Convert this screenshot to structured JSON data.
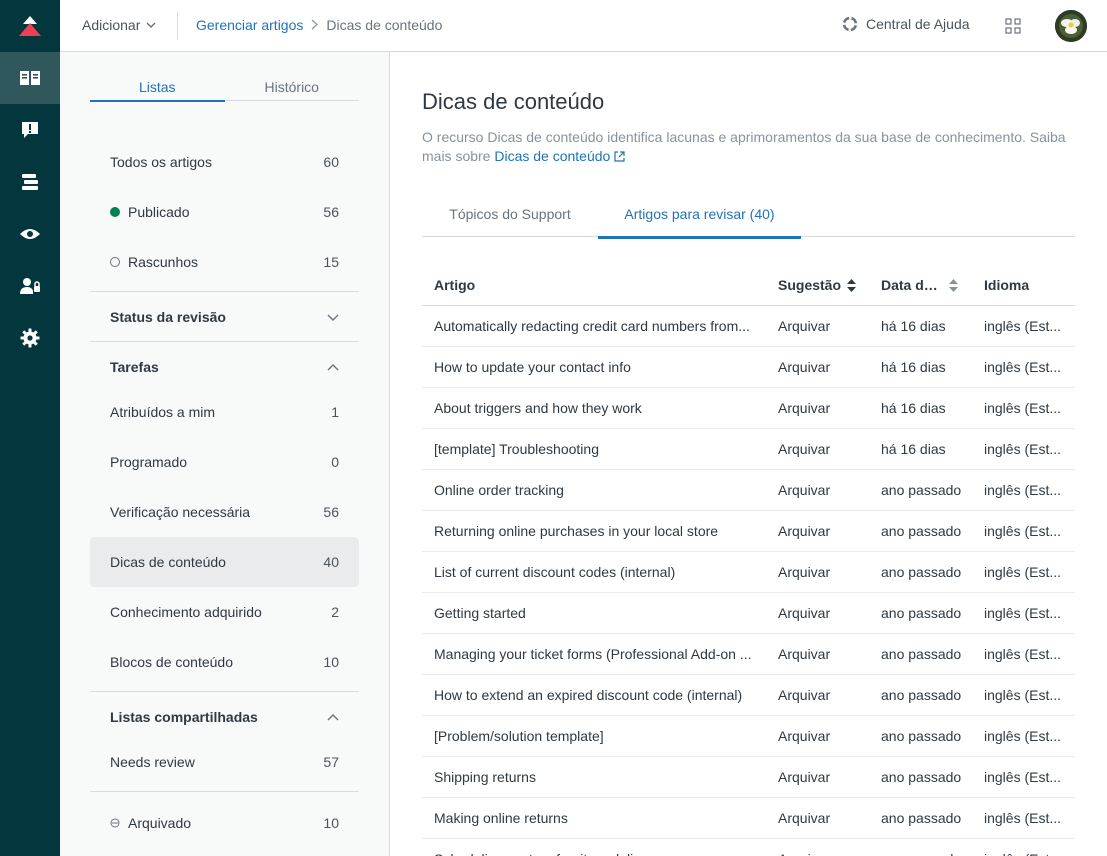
{
  "topbar": {
    "add_label": "Adicionar",
    "breadcrumb": {
      "parent": "Gerenciar artigos",
      "current": "Dicas de conteúdo"
    },
    "help_label": "Central de Ajuda"
  },
  "left_panel": {
    "tabs": [
      "Listas",
      "Histórico"
    ],
    "all_articles": {
      "label": "Todos os artigos",
      "count": "60"
    },
    "published": {
      "label": "Publicado",
      "count": "56"
    },
    "drafts": {
      "label": "Rascunhos",
      "count": "15"
    },
    "review_status": {
      "label": "Status da revisão"
    },
    "tasks": {
      "label": "Tarefas",
      "items": [
        {
          "label": "Atribuídos a mim",
          "count": "1"
        },
        {
          "label": "Programado",
          "count": "0"
        },
        {
          "label": "Verificação necessária",
          "count": "56"
        },
        {
          "label": "Dicas de conteúdo",
          "count": "40"
        },
        {
          "label": "Conhecimento adquirido",
          "count": "2"
        },
        {
          "label": "Blocos de conteúdo",
          "count": "10"
        }
      ]
    },
    "shared_lists": {
      "label": "Listas compartilhadas",
      "items": [
        {
          "label": "Needs review",
          "count": "57"
        }
      ]
    },
    "archived": {
      "label": "Arquivado",
      "count": "10"
    }
  },
  "main": {
    "title": "Dicas de conteúdo",
    "description": "O recurso Dicas de conteúdo identifica lacunas e aprimoramentos da sua base de conhecimento. Saiba mais sobre",
    "description_link": "Dicas de conteúdo",
    "tabs": [
      "Tópicos do Support",
      "Artigos para revisar (40)"
    ],
    "columns": {
      "article": "Artigo",
      "suggestion": "Sugestão",
      "date": "Data da...",
      "language": "Idioma"
    },
    "rows": [
      {
        "article": "Automatically redacting credit card numbers from...",
        "suggestion": "Arquivar",
        "date": "há 16 dias",
        "language": "inglês (Est..."
      },
      {
        "article": "How to update your contact info",
        "suggestion": "Arquivar",
        "date": "há 16 dias",
        "language": "inglês (Est..."
      },
      {
        "article": "About triggers and how they work",
        "suggestion": "Arquivar",
        "date": "há 16 dias",
        "language": "inglês (Est..."
      },
      {
        "article": "[template] Troubleshooting",
        "suggestion": "Arquivar",
        "date": "há 16 dias",
        "language": "inglês (Est..."
      },
      {
        "article": "Online order tracking",
        "suggestion": "Arquivar",
        "date": "ano passado",
        "language": "inglês (Est..."
      },
      {
        "article": "Returning online purchases in your local store",
        "suggestion": "Arquivar",
        "date": "ano passado",
        "language": "inglês (Est..."
      },
      {
        "article": "List of current discount codes (internal)",
        "suggestion": "Arquivar",
        "date": "ano passado",
        "language": "inglês (Est..."
      },
      {
        "article": "Getting started",
        "suggestion": "Arquivar",
        "date": "ano passado",
        "language": "inglês (Est..."
      },
      {
        "article": "Managing your ticket forms (Professional Add-on ...",
        "suggestion": "Arquivar",
        "date": "ano passado",
        "language": "inglês (Est..."
      },
      {
        "article": "How to extend an expired discount code (internal)",
        "suggestion": "Arquivar",
        "date": "ano passado",
        "language": "inglês (Est..."
      },
      {
        "article": "[Problem/solution template]",
        "suggestion": "Arquivar",
        "date": "ano passado",
        "language": "inglês (Est..."
      },
      {
        "article": "Shipping returns",
        "suggestion": "Arquivar",
        "date": "ano passado",
        "language": "inglês (Est..."
      },
      {
        "article": "Making online returns",
        "suggestion": "Arquivar",
        "date": "ano passado",
        "language": "inglês (Est..."
      },
      {
        "article": "Scheduling custom furniture delivery",
        "suggestion": "Arquivar",
        "date": "ano passado",
        "language": "inglês (Est..."
      }
    ]
  },
  "colors": {
    "rail": "#03363d",
    "rail_active": "#30575c",
    "brand_red": "#ef3f54",
    "link_blue": "#1f73b7",
    "published_green": "#038153"
  },
  "icons": {
    "rail": [
      "zendesk-logo-icon",
      "articles-icon",
      "content-cues-icon",
      "arrange-content-icon",
      "preview-icon",
      "user-permissions-icon",
      "settings-icon"
    ],
    "topbar": [
      "chevron-down-icon",
      "lifesaver-icon",
      "apps-grid-icon",
      "avatar"
    ]
  }
}
